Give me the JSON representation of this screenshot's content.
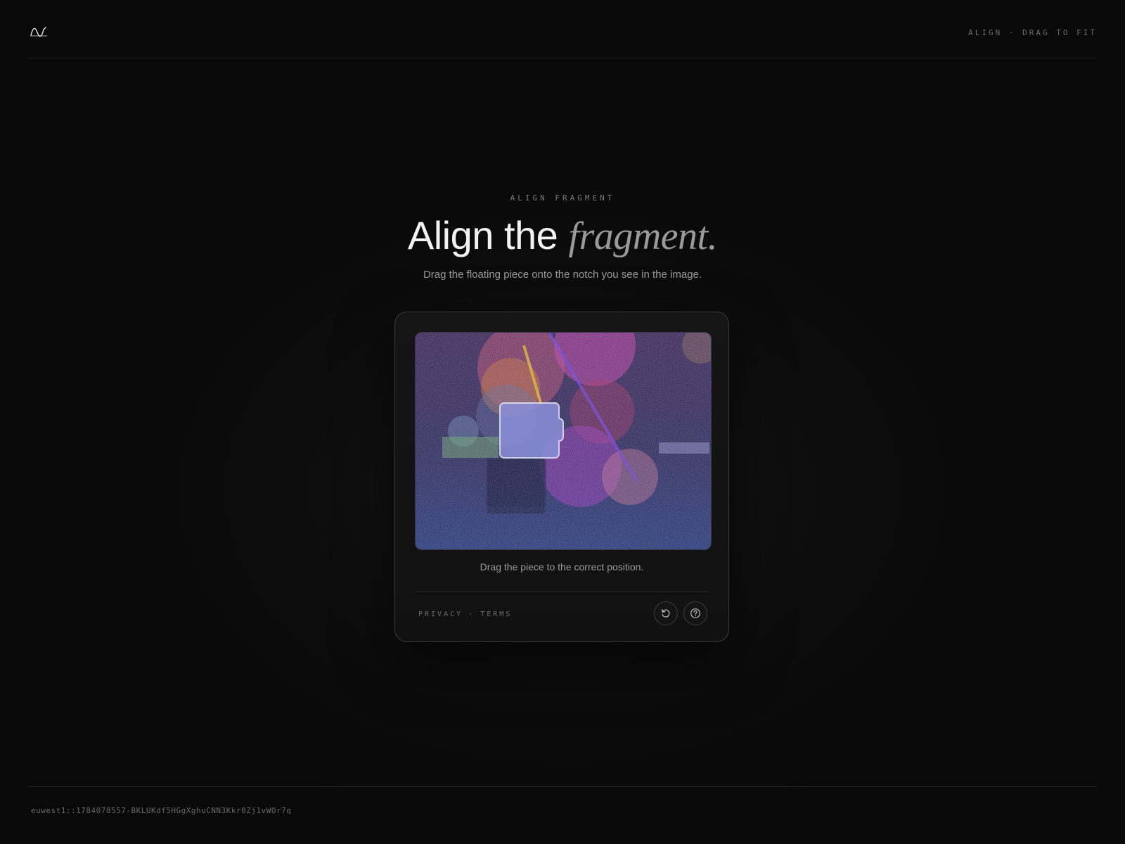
{
  "header": {
    "logo_icon": "wave-logo-icon",
    "tag": "ALIGN · DRAG TO FIT"
  },
  "hero": {
    "eyebrow": "ALIGN FRAGMENT",
    "headline_plain": "Align the ",
    "headline_accent": "fragment.",
    "subtitle": "Drag the floating piece onto the notch you see in the image."
  },
  "challenge": {
    "instruction": "Drag the piece to the correct position.",
    "links": {
      "privacy": "PRIVACY",
      "separator": "·",
      "terms": "TERMS"
    },
    "refresh_icon": "refresh-icon",
    "help_icon": "help-icon"
  },
  "footer": {
    "session_id": "euwest1::1784078557-BKLUKdf5HGgXghuCNN3Kkr0Zj1vWOr7q"
  },
  "colors": {
    "background": "#0a0a0a",
    "card_border": "#3a3a3a",
    "text_muted": "#9a9a9a"
  }
}
